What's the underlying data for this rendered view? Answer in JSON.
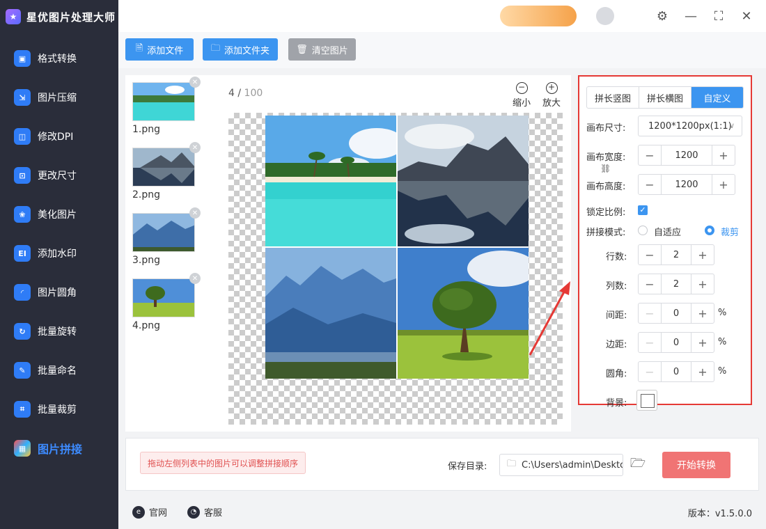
{
  "app": {
    "title": "星优图片处理大师"
  },
  "sidebar": {
    "items": [
      {
        "label": "格式转换",
        "icon": "image-convert-icon"
      },
      {
        "label": "图片压缩",
        "icon": "image-compress-icon"
      },
      {
        "label": "修改DPI",
        "icon": "dpi-icon"
      },
      {
        "label": "更改尺寸",
        "icon": "resize-icon"
      },
      {
        "label": "美化图片",
        "icon": "beautify-icon"
      },
      {
        "label": "添加水印",
        "icon": "watermark-icon"
      },
      {
        "label": "图片圆角",
        "icon": "round-corner-icon"
      },
      {
        "label": "批量旋转",
        "icon": "rotate-icon"
      },
      {
        "label": "批量命名",
        "icon": "rename-icon"
      },
      {
        "label": "批量裁剪",
        "icon": "crop-icon"
      },
      {
        "label": "图片拼接",
        "icon": "stitch-icon",
        "active": true
      }
    ]
  },
  "toolbar": {
    "add_file": "添加文件",
    "add_folder": "添加文件夹",
    "clear": "清空图片"
  },
  "files": [
    {
      "name": "1.png"
    },
    {
      "name": "2.png"
    },
    {
      "name": "3.png"
    },
    {
      "name": "4.png"
    }
  ],
  "preview": {
    "current": "4",
    "separator": " / ",
    "total": "100",
    "zoom_out": "缩小",
    "zoom_in": "放大"
  },
  "settings": {
    "tabs": [
      {
        "label": "拼长竖图"
      },
      {
        "label": "拼长横图"
      },
      {
        "label": "自定义",
        "active": true
      }
    ],
    "canvas_size_label": "画布尺寸:",
    "canvas_size_value": "1200*1200px(1:1)",
    "width_label": "画布宽度:",
    "width_value": "1200",
    "height_label": "画布高度:",
    "height_value": "1200",
    "lock_ratio_label": "锁定比例:",
    "lock_ratio_checked": true,
    "mode_label": "拼接模式:",
    "mode_options": [
      "自适应",
      "裁剪"
    ],
    "mode_selected": "裁剪",
    "rows_label": "行数:",
    "rows_value": "2",
    "cols_label": "列数:",
    "cols_value": "2",
    "spacing_label": "间距:",
    "spacing_value": "0",
    "margin_label": "边距:",
    "margin_value": "0",
    "radius_label": "圆角:",
    "radius_value": "0",
    "percent": "%",
    "bg_label": "背景:",
    "bg_color": "#ffffff"
  },
  "bottom": {
    "tip": "拖动左侧列表中的图片可以调整拼接顺序",
    "save_label": "保存目录:",
    "save_path": "C:\\Users\\admin\\Deskto",
    "start": "开始转换"
  },
  "footer": {
    "website": "官网",
    "support": "客服",
    "version": "版本：v1.5.0.0"
  },
  "colors": {
    "accent": "#3c95f0",
    "sidebar_bg": "#2a2d3a",
    "start_button": "#f07474",
    "highlight_border": "#e53935"
  }
}
